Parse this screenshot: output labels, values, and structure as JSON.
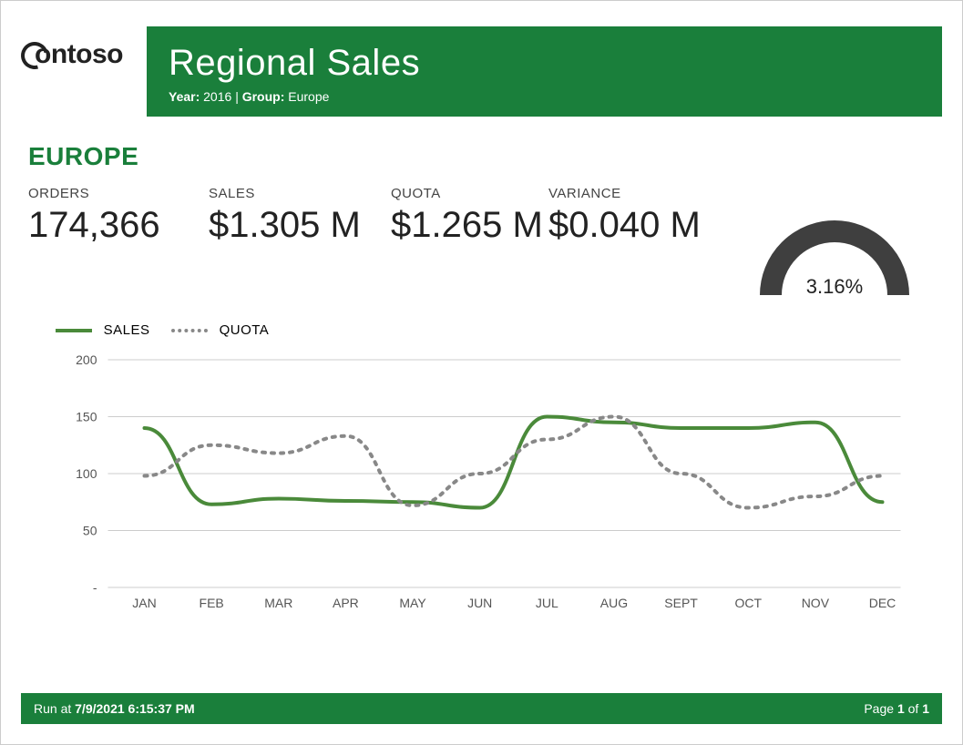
{
  "logo_text": "ontoso",
  "banner": {
    "title": "Regional Sales",
    "year_label": "Year:",
    "year_value": "2016",
    "group_label": "Group:",
    "group_value": "Europe"
  },
  "region_heading": "EUROPE",
  "metrics": {
    "orders_label": "ORDERS",
    "orders_value": "174,366",
    "sales_label": "SALES",
    "sales_value": "$1.305 M",
    "quota_label": "QUOTA",
    "quota_value": "$1.265 M",
    "variance_label": "VARIANCE",
    "variance_value": "$0.040 M"
  },
  "gauge": {
    "percent_label": "3.16%",
    "percent": 3.16
  },
  "legend": {
    "sales": "SALES",
    "quota": "QUOTA"
  },
  "footer": {
    "run_prefix": "Run at ",
    "run_timestamp": "7/9/2021 6:15:37 PM",
    "page_prefix": "Page ",
    "page_current": "1",
    "page_of": " of ",
    "page_total": "1"
  },
  "chart_data": {
    "type": "line",
    "categories": [
      "JAN",
      "FEB",
      "MAR",
      "APR",
      "MAY",
      "JUN",
      "JUL",
      "AUG",
      "SEPT",
      "OCT",
      "NOV",
      "DEC"
    ],
    "series": [
      {
        "name": "SALES",
        "values": [
          140,
          73,
          78,
          76,
          75,
          70,
          150,
          145,
          140,
          140,
          145,
          75
        ],
        "style": "solid",
        "color": "#4a8a3a"
      },
      {
        "name": "QUOTA",
        "values": [
          98,
          125,
          118,
          133,
          72,
          100,
          130,
          150,
          100,
          70,
          80,
          98
        ],
        "style": "dotted",
        "color": "#888888"
      }
    ],
    "y_ticks": [
      "-",
      "50",
      "100",
      "150",
      "200"
    ],
    "y_values": [
      0,
      50,
      100,
      150,
      200
    ],
    "ylim": [
      0,
      200
    ],
    "title": "",
    "xlabel": "",
    "ylabel": ""
  }
}
